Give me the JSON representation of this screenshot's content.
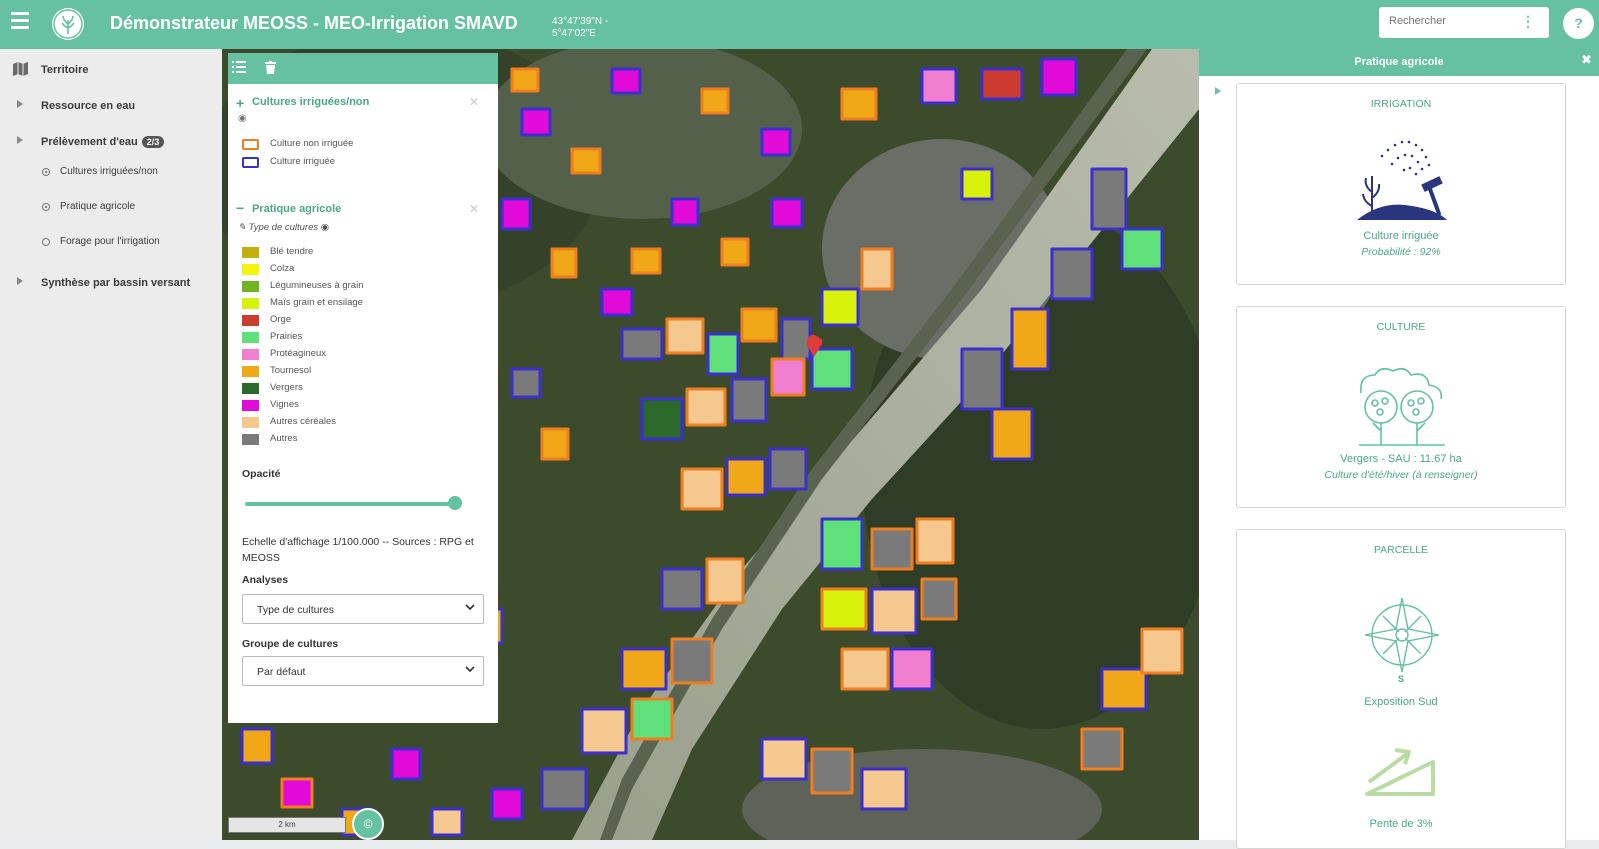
{
  "header": {
    "title": "Démonstrateur MEOSS - MEO-Irrigation SMAVD",
    "coords_lat": "43°47'39\"N -",
    "coords_lon": "5°47'02\"E",
    "search_placeholder": "Rechercher",
    "help_label": "?"
  },
  "sidebar": {
    "items": [
      {
        "label": "Territoire",
        "icon": "map-icon"
      },
      {
        "label": "Ressource en eau",
        "icon": "chevron-right-icon"
      },
      {
        "label": "Prélèvement d'eau",
        "icon": "chevron-right-icon",
        "badge": "2/3"
      },
      {
        "label": "Synthèse par bassin versant",
        "icon": "chevron-right-icon"
      }
    ],
    "subitems": [
      {
        "label": "Cultures irriguées/non",
        "checked": true
      },
      {
        "label": "Pratique agricole",
        "checked": true
      },
      {
        "label": "Forage pour l'irrigation",
        "checked": false
      }
    ]
  },
  "legend": {
    "section1": {
      "title": "Cultures irriguées/non",
      "items": [
        {
          "label": "Culture non irriguée",
          "color": "#f07d1e"
        },
        {
          "label": "Culture irriguée",
          "color": "#3b2fd0"
        }
      ]
    },
    "section2": {
      "title": "Pratique agricole",
      "subtitle": "Type de cultures",
      "items": [
        {
          "label": "Blé tendre",
          "color": "#c4ae0c"
        },
        {
          "label": "Colza",
          "color": "#f6f40e"
        },
        {
          "label": "Légumineuses à grain",
          "color": "#6eb51f"
        },
        {
          "label": "Maïs grain et ensilage",
          "color": "#d6f20b"
        },
        {
          "label": "Orge",
          "color": "#cb3b30"
        },
        {
          "label": "Prairies",
          "color": "#5fe07a"
        },
        {
          "label": "Protéagineux",
          "color": "#f07fd0"
        },
        {
          "label": "Tournesol",
          "color": "#f0a818"
        },
        {
          "label": "Vergers",
          "color": "#2b6a2a"
        },
        {
          "label": "Vignes",
          "color": "#e10ad8"
        },
        {
          "label": "Autres céréales",
          "color": "#f5c890"
        },
        {
          "label": "Autres",
          "color": "#7a7a7a"
        }
      ]
    },
    "opacity_label": "Opacité",
    "opacity_value": 1.0,
    "source_text": "Echelle d'affichage 1/100.000 -- Sources : RPG et MEOSS",
    "analyses_label": "Analyses",
    "analyses_value": "Type de cultures",
    "groupe_label": "Groupe de cultures",
    "groupe_value": "Par défaut"
  },
  "map": {
    "scale_label": "2 km",
    "copyright_label": "©"
  },
  "panel": {
    "title": "Pratique agricole",
    "cards": [
      {
        "title": "IRRIGATION",
        "text": "Culture irriguée",
        "sub": "Probabilité : 92%"
      },
      {
        "title": "CULTURE",
        "text": "Vergers - SAU : 11.67 ha",
        "sub": "Culture d'été/hiver (à renseigner)"
      },
      {
        "title": "PARCELLE",
        "compass_label": "S",
        "text": "Exposition Sud",
        "text2": "Pente de 3%"
      }
    ]
  },
  "colors": {
    "accent": "#65c1a1",
    "accent_text": "#4aa886"
  }
}
